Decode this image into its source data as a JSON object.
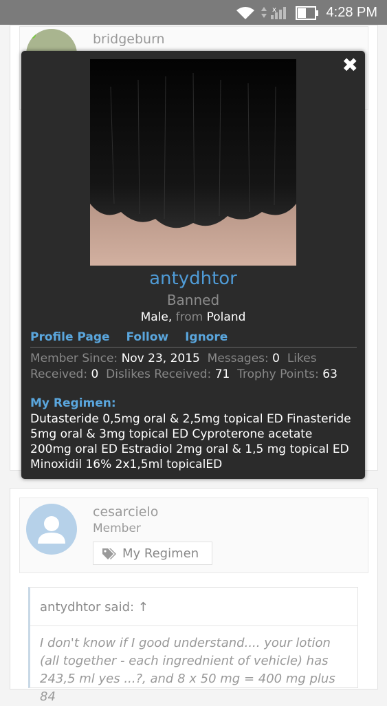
{
  "status_bar": {
    "time": "4:28 PM"
  },
  "posts": [
    {
      "username": "bridgeburn"
    },
    {
      "username": "cesarcielo",
      "user_title": "Member",
      "regimen_button": "My Regimen"
    }
  ],
  "quote": {
    "header": "antydhtor said: ↑",
    "body": "I don't know if I good understand.... your lotion (all together - each ingrednient of vehicle) has 243,5 ml yes ...?, and 8 x 50 mg = 400 mg plus 84"
  },
  "profile_popup": {
    "close_glyph": "✖",
    "username": "antydhtor",
    "status": "Banned",
    "gender": "Male,",
    "from_word": "from",
    "country": "Poland",
    "links": {
      "profile": "Profile Page",
      "follow": "Follow",
      "ignore": "Ignore"
    },
    "stats": {
      "member_since_label": "Member Since:",
      "member_since": "Nov 23, 2015",
      "messages_label": "Messages:",
      "messages": "0",
      "likes_label": "Likes Received:",
      "likes": "0",
      "dislikes_label": "Dislikes Received:",
      "dislikes": "71",
      "trophy_label": "Trophy Points:",
      "trophy": "63"
    },
    "regimen_label": "My Regimen:",
    "regimen_text": "Dutasteride 0,5mg oral & 2,5mg topical ED Finasteride 5mg oral & 3mg topical ED Cyproterone acetate 200mg oral ED Estradiol 2mg oral & 1,5 mg topical ED Minoxidil 16% 2x1,5ml topicalED"
  }
}
